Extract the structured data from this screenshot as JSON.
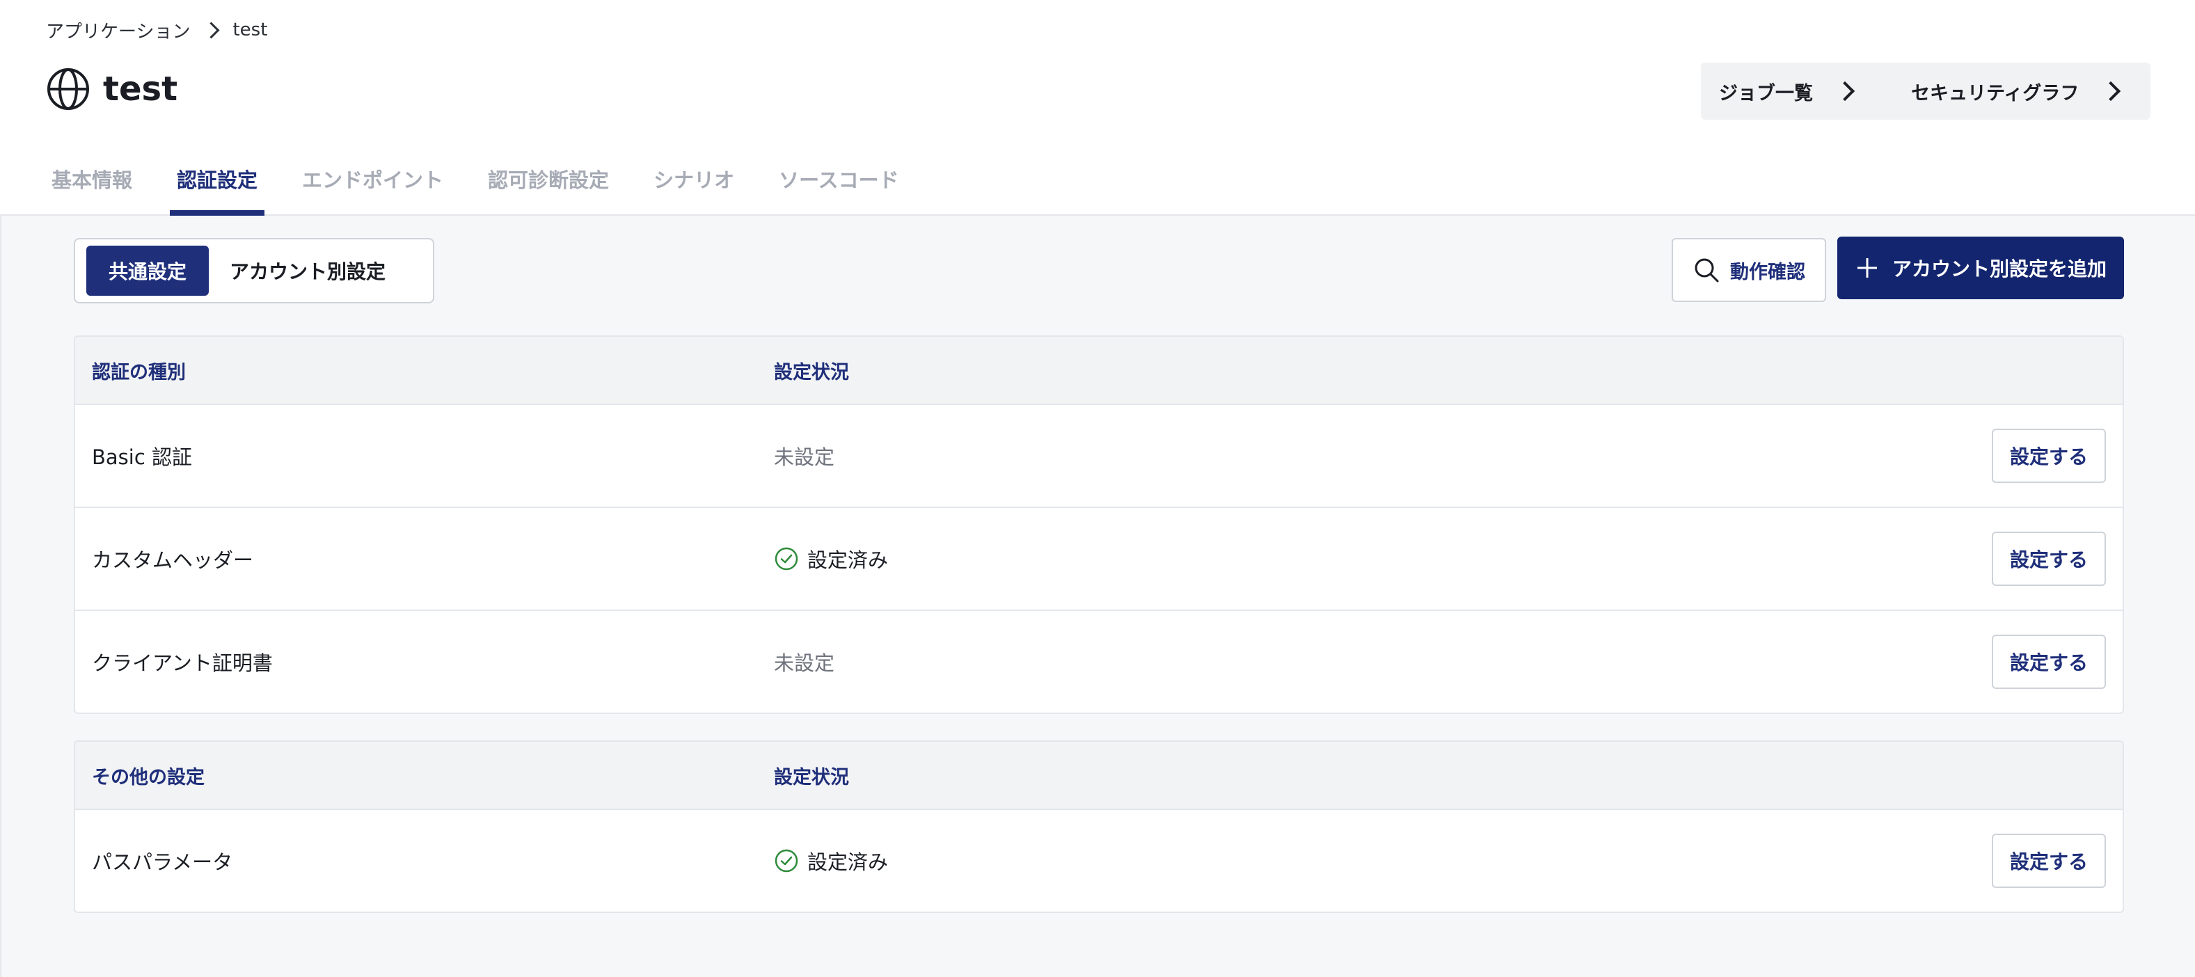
{
  "breadcrumb": {
    "root": "アプリケーション",
    "current": "test"
  },
  "app": {
    "title": "test",
    "icon": "globe-icon"
  },
  "top_buttons": {
    "jobs": "ジョブ一覧",
    "graph": "セキュリティグラフ"
  },
  "tabs": [
    {
      "label": "基本情報",
      "active": false
    },
    {
      "label": "認証設定",
      "active": true
    },
    {
      "label": "エンドポイント",
      "active": false
    },
    {
      "label": "認可診断設定",
      "active": false
    },
    {
      "label": "シナリオ",
      "active": false
    },
    {
      "label": "ソースコード",
      "active": false
    }
  ],
  "segment": {
    "common": "共通設定",
    "per_account": "アカウント別設定",
    "selected": "common"
  },
  "actions": {
    "verify": "動作確認",
    "add": "アカウント別設定を追加"
  },
  "auth_table": {
    "header": {
      "type": "認証の種別",
      "status": "設定状況"
    },
    "rows": [
      {
        "name": "Basic 認証",
        "status": "未設定",
        "configured": false,
        "action": "設定する"
      },
      {
        "name": "カスタムヘッダー",
        "status": "設定済み",
        "configured": true,
        "action": "設定する"
      },
      {
        "name": "クライアント証明書",
        "status": "未設定",
        "configured": false,
        "action": "設定する"
      }
    ]
  },
  "other_table": {
    "header": {
      "type": "その他の設定",
      "status": "設定状況"
    },
    "rows": [
      {
        "name": "パスパラメータ",
        "status": "設定済み",
        "configured": true,
        "action": "設定する"
      }
    ]
  },
  "colors": {
    "primary": "#1f2f7a",
    "primary_dark": "#13256e",
    "success": "#2e8b3a",
    "muted": "#a6abb5"
  }
}
